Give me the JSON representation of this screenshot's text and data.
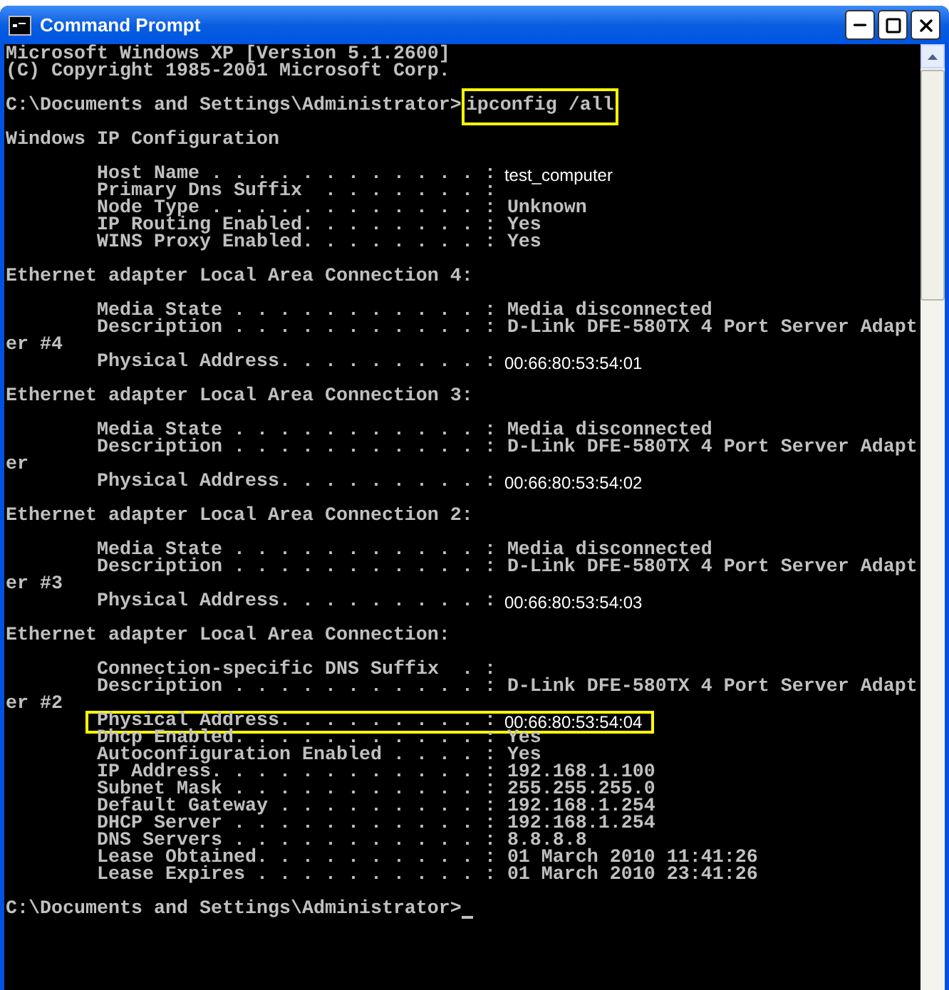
{
  "window": {
    "title": "Command Prompt"
  },
  "console": {
    "lines": [
      {
        "kind": "plain",
        "text": "Microsoft Windows XP [Version 5.1.2600]"
      },
      {
        "kind": "plain",
        "text": "(C) Copyright 1985-2001 Microsoft Corp."
      },
      {
        "kind": "blank"
      },
      {
        "kind": "prompt",
        "text": "C:\\Documents and Settings\\Administrator>",
        "command": "ipconfig /all",
        "highlighted": true,
        "cursor": false
      },
      {
        "kind": "blank"
      },
      {
        "kind": "plain",
        "text": "Windows IP Configuration"
      },
      {
        "kind": "blank"
      },
      {
        "kind": "field",
        "label": "Host Name . . . . . . . . . . . . :",
        "value": "test_computer",
        "edited": true,
        "highlighted": false
      },
      {
        "kind": "field",
        "label": "Primary Dns Suffix  . . . . . . . :",
        "highlighted": false
      },
      {
        "kind": "field",
        "label": "Node Type . . . . . . . . . . . . :",
        "value": "Unknown",
        "edited": false,
        "highlighted": false
      },
      {
        "kind": "field",
        "label": "IP Routing Enabled. . . . . . . . :",
        "value": "Yes",
        "edited": false,
        "highlighted": false
      },
      {
        "kind": "field",
        "label": "WINS Proxy Enabled. . . . . . . . :",
        "value": "Yes",
        "edited": false,
        "highlighted": false
      },
      {
        "kind": "blank"
      },
      {
        "kind": "plain",
        "text": "Ethernet adapter Local Area Connection 4:"
      },
      {
        "kind": "blank"
      },
      {
        "kind": "field",
        "label": "Media State . . . . . . . . . . . :",
        "value": "Media disconnected",
        "edited": false,
        "highlighted": false
      },
      {
        "kind": "field",
        "label": "Description . . . . . . . . . . . :",
        "value": "D-Link DFE-580TX 4 Port Server Adapt",
        "edited": false,
        "highlighted": false
      },
      {
        "kind": "plain",
        "text": "er #4"
      },
      {
        "kind": "field",
        "label": "Physical Address. . . . . . . . . :",
        "value": "00:66:80:53:54:01",
        "edited": true,
        "highlighted": false
      },
      {
        "kind": "blank"
      },
      {
        "kind": "plain",
        "text": "Ethernet adapter Local Area Connection 3:"
      },
      {
        "kind": "blank"
      },
      {
        "kind": "field",
        "label": "Media State . . . . . . . . . . . :",
        "value": "Media disconnected",
        "edited": false,
        "highlighted": false
      },
      {
        "kind": "field",
        "label": "Description . . . . . . . . . . . :",
        "value": "D-Link DFE-580TX 4 Port Server Adapt",
        "edited": false,
        "highlighted": false
      },
      {
        "kind": "plain",
        "text": "er"
      },
      {
        "kind": "field",
        "label": "Physical Address. . . . . . . . . :",
        "value": "00:66:80:53:54:02",
        "edited": true,
        "highlighted": false
      },
      {
        "kind": "blank"
      },
      {
        "kind": "plain",
        "text": "Ethernet adapter Local Area Connection 2:"
      },
      {
        "kind": "blank"
      },
      {
        "kind": "field",
        "label": "Media State . . . . . . . . . . . :",
        "value": "Media disconnected",
        "edited": false,
        "highlighted": false
      },
      {
        "kind": "field",
        "label": "Description . . . . . . . . . . . :",
        "value": "D-Link DFE-580TX 4 Port Server Adapt",
        "edited": false,
        "highlighted": false
      },
      {
        "kind": "plain",
        "text": "er #3"
      },
      {
        "kind": "field",
        "label": "Physical Address. . . . . . . . . :",
        "value": "00:66:80:53:54:03",
        "edited": true,
        "highlighted": false
      },
      {
        "kind": "blank"
      },
      {
        "kind": "plain",
        "text": "Ethernet adapter Local Area Connection:"
      },
      {
        "kind": "blank"
      },
      {
        "kind": "field",
        "label": "Connection-specific DNS Suffix  . :",
        "highlighted": false
      },
      {
        "kind": "field",
        "label": "Description . . . . . . . . . . . :",
        "value": "D-Link DFE-580TX 4 Port Server Adapt",
        "edited": false,
        "highlighted": false
      },
      {
        "kind": "plain",
        "text": "er #2"
      },
      {
        "kind": "field",
        "label": "Physical Address. . . . . . . . . :",
        "value": "00:66:80:53:54:04",
        "edited": true,
        "highlighted": true
      },
      {
        "kind": "field",
        "label": "Dhcp Enabled. . . . . . . . . . . :",
        "value": "Yes",
        "edited": false,
        "highlighted": false
      },
      {
        "kind": "field",
        "label": "Autoconfiguration Enabled . . . . :",
        "value": "Yes",
        "edited": false,
        "highlighted": false
      },
      {
        "kind": "field",
        "label": "IP Address. . . . . . . . . . . . :",
        "value": "192.168.1.100",
        "edited": false,
        "highlighted": false
      },
      {
        "kind": "field",
        "label": "Subnet Mask . . . . . . . . . . . :",
        "value": "255.255.255.0",
        "edited": false,
        "highlighted": false
      },
      {
        "kind": "field",
        "label": "Default Gateway . . . . . . . . . :",
        "value": "192.168.1.254",
        "edited": false,
        "highlighted": false
      },
      {
        "kind": "field",
        "label": "DHCP Server . . . . . . . . . . . :",
        "value": "192.168.1.254",
        "edited": false,
        "highlighted": false
      },
      {
        "kind": "field",
        "label": "DNS Servers . . . . . . . . . . . :",
        "value": "8.8.8.8",
        "edited": false,
        "highlighted": false
      },
      {
        "kind": "field",
        "label": "Lease Obtained. . . . . . . . . . :",
        "value": "01 March 2010 11:41:26",
        "edited": false,
        "highlighted": false
      },
      {
        "kind": "field",
        "label": "Lease Expires . . . . . . . . . . :",
        "value": "01 March 2010 23:41:26",
        "edited": false,
        "highlighted": false
      },
      {
        "kind": "blank"
      },
      {
        "kind": "prompt",
        "text": "C:\\Documents and Settings\\Administrator>",
        "cursor": true
      }
    ]
  }
}
